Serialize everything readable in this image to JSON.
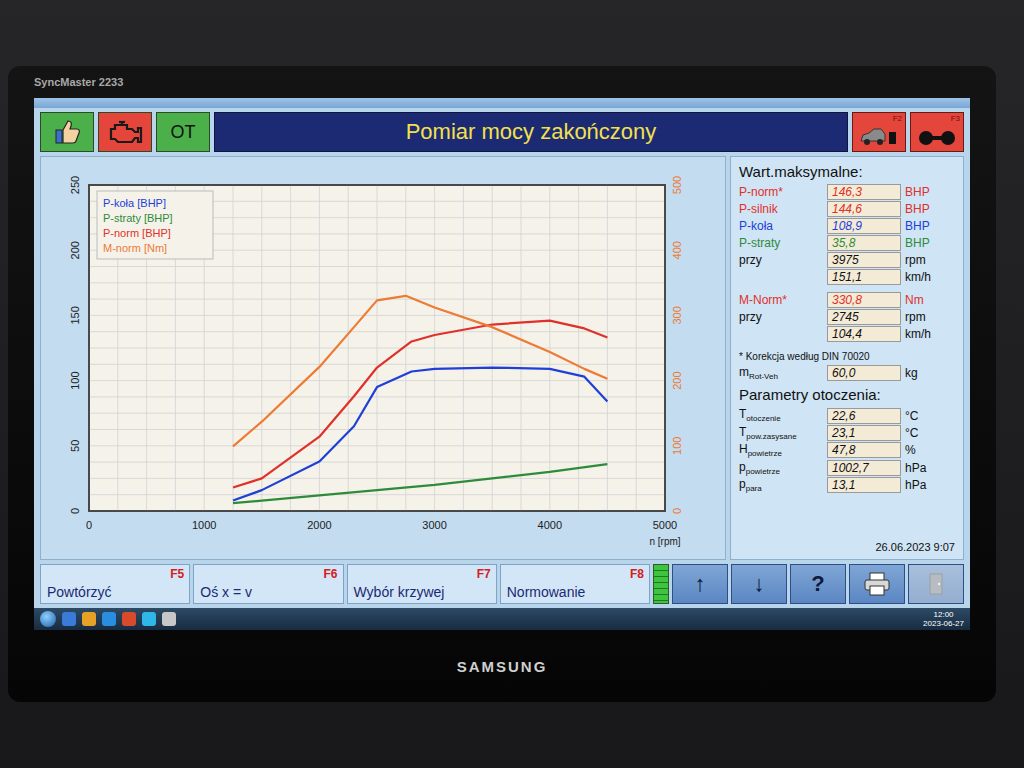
{
  "monitor": {
    "model": "SyncMaster 2233",
    "brand": "SAMSUNG"
  },
  "header": {
    "left_buttons": [
      {
        "kind": "thumb",
        "label": "",
        "color": "#4cb04a"
      },
      {
        "kind": "engine",
        "label": "",
        "color": "#e4463c"
      },
      {
        "kind": "text",
        "label": "OT",
        "color": "#4cb04a"
      }
    ],
    "title": "Pomiar mocy zakończony",
    "right_buttons": [
      {
        "key": "F2",
        "kind": "car"
      },
      {
        "key": "F3",
        "kind": "rollers"
      }
    ]
  },
  "chart": {
    "x_ticks": [
      "0",
      "1000",
      "2000",
      "3000",
      "4000",
      "5000"
    ],
    "x_label": "n [rpm]",
    "y_left_ticks": [
      "0",
      "50",
      "100",
      "150",
      "200",
      "250"
    ],
    "y_right_ticks": [
      "0",
      "100",
      "200",
      "300",
      "400",
      "500"
    ],
    "series": [
      {
        "name": "P-koła [BHP]",
        "color": "#1f3fd6",
        "axis": "left",
        "rpm": [
          1250,
          1500,
          2000,
          2300,
          2500,
          2800,
          3000,
          3500,
          4000,
          4300,
          4500
        ],
        "values": [
          8,
          16,
          38,
          65,
          95,
          107,
          109,
          110,
          109,
          103,
          84
        ]
      },
      {
        "name": "P-straty [BHP]",
        "color": "#2e8b3a",
        "axis": "left",
        "rpm": [
          1250,
          1500,
          2000,
          2500,
          3000,
          3500,
          4000,
          4500
        ],
        "values": [
          6,
          8,
          12,
          16,
          20,
          25,
          30,
          36
        ]
      },
      {
        "name": "P-norm [BHP]",
        "color": "#e0302a",
        "axis": "left",
        "rpm": [
          1250,
          1500,
          2000,
          2300,
          2500,
          2800,
          3000,
          3500,
          4000,
          4300,
          4500
        ],
        "values": [
          18,
          25,
          57,
          88,
          110,
          130,
          135,
          143,
          146,
          140,
          133
        ]
      },
      {
        "name": "M-norm [Nm]",
        "color": "#ee7a33",
        "axis": "right",
        "rpm": [
          1250,
          1500,
          2000,
          2300,
          2500,
          2750,
          3000,
          3500,
          4000,
          4300,
          4500
        ],
        "values": [
          99,
          137,
          221,
          282,
          323,
          330,
          312,
          282,
          244,
          218,
          203
        ]
      }
    ]
  },
  "max_values": {
    "title": "Wart.maksymalne:",
    "groups": [
      [
        {
          "label": "P-norm*",
          "value": "146,3",
          "unit": "BHP",
          "color": "#e0302a"
        },
        {
          "label": "P-silnik",
          "value": "144,6",
          "unit": "BHP",
          "color": "#e0302a"
        },
        {
          "label": "P-koła",
          "value": "108,9",
          "unit": "BHP",
          "color": "#1f3fd6"
        },
        {
          "label": "P-straty",
          "value": "35,8",
          "unit": "BHP",
          "color": "#2e8b3a"
        },
        {
          "label": "przy",
          "value": "3975",
          "unit": "rpm",
          "color": "#111111"
        },
        {
          "label": "",
          "value": "151,1",
          "unit": "km/h",
          "color": "#111111"
        }
      ],
      [
        {
          "label": "M-Norm*",
          "value": "330,8",
          "unit": "Nm",
          "color": "#e0302a"
        },
        {
          "label": "przy",
          "value": "2745",
          "unit": "rpm",
          "color": "#111111"
        },
        {
          "label": "",
          "value": "104,4",
          "unit": "km/h",
          "color": "#111111"
        }
      ]
    ],
    "note": "* Korekcja według DIN 70020",
    "mass": {
      "symbol": "m",
      "sub": "Rot-Veh",
      "value": "60,0",
      "unit": "kg"
    }
  },
  "ambient": {
    "title": "Parametry otoczenia:",
    "rows": [
      {
        "symbol": "T",
        "sub": "otoczenie",
        "value": "22,6",
        "unit": "°C"
      },
      {
        "symbol": "T",
        "sub": "pow.zasysane",
        "value": "23,1",
        "unit": "°C"
      },
      {
        "symbol": "H",
        "sub": "powietrze",
        "value": "47,8",
        "unit": "%"
      },
      {
        "symbol": "p",
        "sub": "powietrze",
        "value": "1002,7",
        "unit": "hPa"
      },
      {
        "symbol": "p",
        "sub": "para",
        "value": "13,1",
        "unit": "hPa"
      }
    ],
    "date": "26.06.2023 9:07"
  },
  "function_keys": [
    {
      "key": "F5",
      "label": "Powtórzyć"
    },
    {
      "key": "F6",
      "label": "Oś x = v"
    },
    {
      "key": "F7",
      "label": "Wybór krzywej"
    },
    {
      "key": "F8",
      "label": "Normowanie"
    }
  ],
  "indicator": {
    "level": 1
  },
  "nav_buttons": [
    "↑",
    "↓",
    "?"
  ],
  "tool_buttons": [
    {
      "kind": "print",
      "disabled": false
    },
    {
      "kind": "exit",
      "disabled": true
    }
  ],
  "taskbar": {
    "time": "12:00",
    "date": "2023-06-27"
  }
}
